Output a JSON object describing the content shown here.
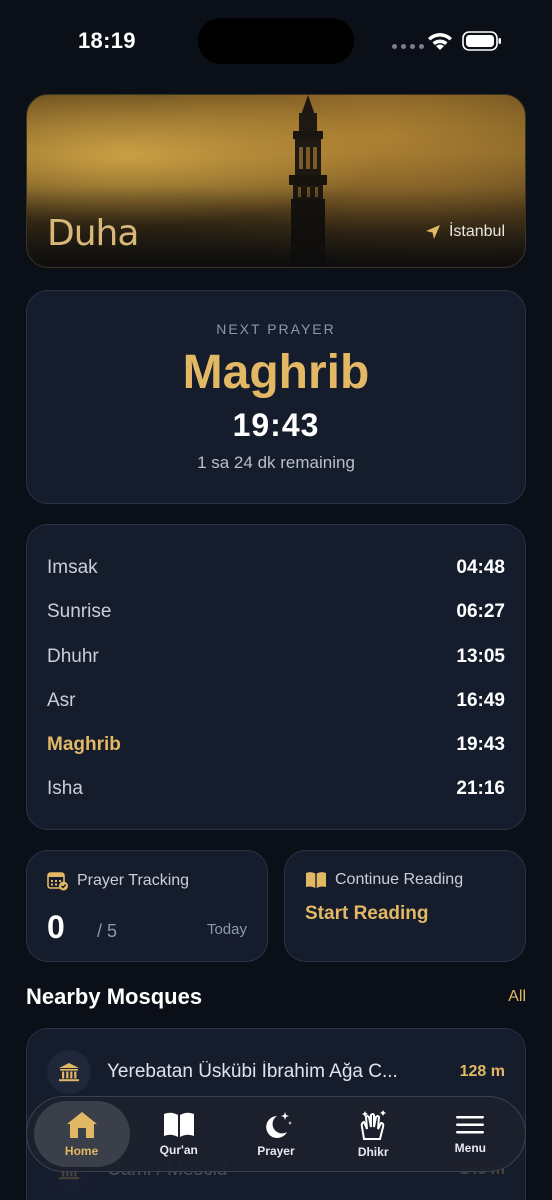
{
  "status_bar": {
    "time": "18:19"
  },
  "hero": {
    "brand": "Duha",
    "location": "İstanbul"
  },
  "next_prayer": {
    "label": "NEXT PRAYER",
    "name": "Maghrib",
    "time": "19:43",
    "remaining": "1 sa 24 dk remaining"
  },
  "prayer_times": [
    {
      "name": "Imsak",
      "time": "04:48",
      "active": false
    },
    {
      "name": "Sunrise",
      "time": "06:27",
      "active": false
    },
    {
      "name": "Dhuhr",
      "time": "13:05",
      "active": false
    },
    {
      "name": "Asr",
      "time": "16:49",
      "active": false
    },
    {
      "name": "Maghrib",
      "time": "19:43",
      "active": true
    },
    {
      "name": "Isha",
      "time": "21:16",
      "active": false
    }
  ],
  "tracking": {
    "title": "Prayer Tracking",
    "count": "0",
    "total": "/ 5",
    "period": "Today"
  },
  "reading": {
    "title": "Continue Reading",
    "action": "Start Reading"
  },
  "nearby": {
    "title": "Nearby Mosques",
    "link": "All",
    "items": [
      {
        "name": "Yerebatan Üskübi İbrahim Ağa C...",
        "distance": "128 m"
      },
      {
        "name": "Cami / Mescid",
        "distance": "146 m"
      }
    ]
  },
  "tabs": [
    {
      "label": "Home",
      "icon": "home-icon",
      "active": true
    },
    {
      "label": "Qur'an",
      "icon": "book-icon",
      "active": false
    },
    {
      "label": "Prayer",
      "icon": "moon-stars-icon",
      "active": false
    },
    {
      "label": "Dhikr",
      "icon": "hands-icon",
      "active": false
    },
    {
      "label": "Menu",
      "icon": "menu-icon",
      "active": false
    }
  ],
  "colors": {
    "accent": "#e2b865",
    "card": "#151c2c",
    "background": "#0b0f17"
  }
}
